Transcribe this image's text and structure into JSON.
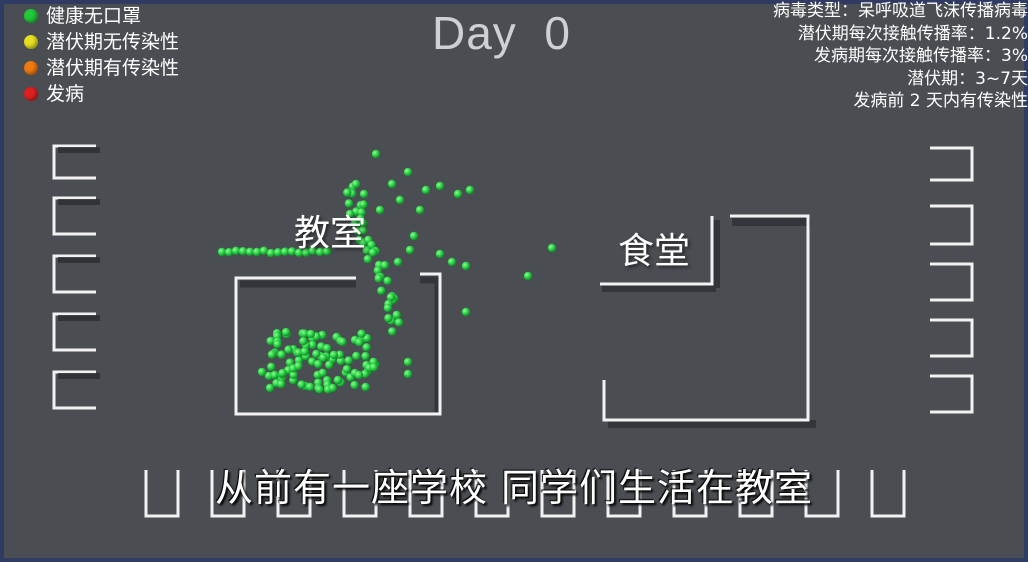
{
  "legend": [
    {
      "label": "健康无口罩",
      "color": "#22c93a"
    },
    {
      "label": "潜伏期无传染性",
      "color": "#e5e020"
    },
    {
      "label": "潜伏期有传染性",
      "color": "#f07a10"
    },
    {
      "label": "发病",
      "color": "#e02020"
    }
  ],
  "day": {
    "label": "Day",
    "value": "0"
  },
  "virus_info": [
    "病毒类型：呆呼吸道飞沫传播病毒",
    "潜伏期每次接触传播率：1.2%",
    "发病期每次接触传播率：3%",
    "潜伏期：3~7天",
    "发病前 2 天内有传染性"
  ],
  "rooms": {
    "classroom": "教室",
    "canteen": "食堂"
  },
  "subtitle": "从前有一座学校 同学们生活在教室",
  "colors": {
    "healthy": "#2bd14a",
    "wall": "#f2f2f2",
    "floor": "#4a4d52"
  }
}
